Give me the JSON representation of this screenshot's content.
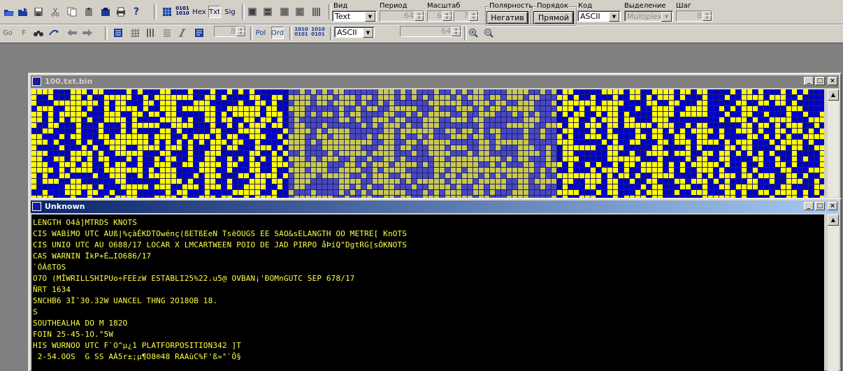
{
  "toolbar1": {
    "buttons": [
      "open-icon",
      "save-as-icon",
      "save-icon",
      "cut-icon",
      "copy-icon",
      "paste-icon",
      "clipboard-icon",
      "print-icon",
      "help-icon",
      "bitmap-mode-icon",
      "binary-mode-icon",
      "hex-mode-icon",
      "text-mode-icon",
      "signal-mode-icon",
      "layout1-icon",
      "layout2-icon",
      "layout3-icon",
      "layout4-icon",
      "layout5-icon"
    ],
    "hex_label": "Hex",
    "txt_label": "Txt",
    "sig_label": "Sig",
    "bin_label_top": "0101",
    "bin_label_bottom": "1010"
  },
  "controls": {
    "vid_label": "Вид",
    "vid_value": "Text",
    "period_label": "Период",
    "period_value": "64",
    "scale_label": "Масштаб",
    "scale_value_a": "6",
    "scale_value_b": "7",
    "polarity_label": "Полярность",
    "polarity_button": "Негатив",
    "order_label": "Порядок",
    "order_button": "Прямой",
    "code_label": "Код",
    "code_value": "ASCII",
    "selection_label": "Выделение",
    "selection_value": "Multiplex",
    "step_label": "Шаг",
    "step_value": "8"
  },
  "toolbar2": {
    "go_label": "Go",
    "f_label": "F",
    "spin_value": "8",
    "pol_label": "Pol",
    "ord_label": "Ord",
    "code2_value": "ASCII",
    "spin2_value": "64",
    "bits1_top": "1010",
    "bits1_bottom": "0101",
    "bits2_top": "1010",
    "bits2_bottom": "0101"
  },
  "window_bitmap": {
    "title": "100.txt.bin",
    "colors": {
      "blue": "#0000c8",
      "yellow": "#ffff00",
      "dimblue": "#4848c0",
      "dimyellow": "#c8c850"
    }
  },
  "window_text": {
    "title": "Unknown",
    "lines": [
      "LENGTH O4â]MTRDS KNOTS",
      "CIS WABîMO UTC AUß|%çàÉKDTOwénç(ßETßEeN TsëOUGS EE SAO&sELANGTH OO METRE[ KnOTS",
      "CIS UNIO UTC AU O688/17 LOCAR X LMCARTWEEN POIO DE JAD PIRPO åÞíQ\"DgtRG[sÓKNOTS",
      "CAS WARNIN ÏkP+É…IO686/17",
      "`ÓÁßTOS",
      "O7O (MÎWRILLSHIPUo÷FEEzW ESTABLI25%22.u5@ OVBAN¡'ÐOMnGUTC SEP 678/17",
      "ÑRT 1634",
      "5NCHB6 3Ï¯30.32W UANCEL THNG 2O18OB 18.",
      "S",
      "SOUTHEALHA DO M 182O",
      "FOIN 25-45-1O.\"5W",
      "HIS WURNOO UTC F`O^µ¿1 PLATFORPOSITION342 ]T",
      " 2-54.OOS  G SS AÀ5r±;µ¶O8®48 RAAùC%F'ß»°`Ô§"
    ]
  }
}
